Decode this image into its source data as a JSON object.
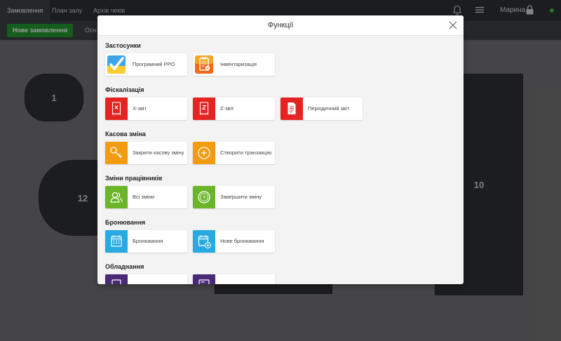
{
  "topbar": {
    "tabs": [
      "Замовлення",
      "План залу",
      "Архів чеків"
    ],
    "user": "Марина"
  },
  "subbar": {
    "new_order": "Нове замовлення",
    "tab": "Осн"
  },
  "floor": {
    "tables": [
      "1",
      "12",
      "10"
    ]
  },
  "modal": {
    "title": "Функції",
    "sections": [
      {
        "title": "Застосунки",
        "items": [
          "Програмний РРО",
          "Інвентаризація"
        ]
      },
      {
        "title": "Фіскалізація",
        "items": [
          "X-звіт",
          "Z-звіт",
          "Періодичний звіт"
        ]
      },
      {
        "title": "Касова зміна",
        "items": [
          "Закрити касову зміну",
          "Створити транзакцію"
        ]
      },
      {
        "title": "Зміни працівників",
        "items": [
          "Всі зміни",
          "Завершити зміну"
        ]
      },
      {
        "title": "Бронювання",
        "items": [
          "Бронювання",
          "Нове бронювання"
        ]
      },
      {
        "title": "Обладнання",
        "items": [
          "",
          ""
        ]
      }
    ]
  },
  "colors": {
    "new_order_green": "#1f8f2b",
    "fiscal_red": "#e52421",
    "cash_orange": "#f39c12",
    "staff_green": "#6bb52a",
    "booking_blue": "#27a9e1",
    "equipment_purple": "#4a2a78"
  },
  "icons": {
    "rro": "checkbox-icon",
    "inventory": "clipboard-icon",
    "x_report": "receipt-x-icon",
    "z_report": "receipt-z-icon",
    "periodic": "document-icon",
    "close_shift": "key-icon",
    "transaction": "plus-circle-icon",
    "all_shifts": "users-icon",
    "end_shift": "clock-icon",
    "booking": "calendar-icon",
    "new_booking": "calendar-plus-icon"
  }
}
